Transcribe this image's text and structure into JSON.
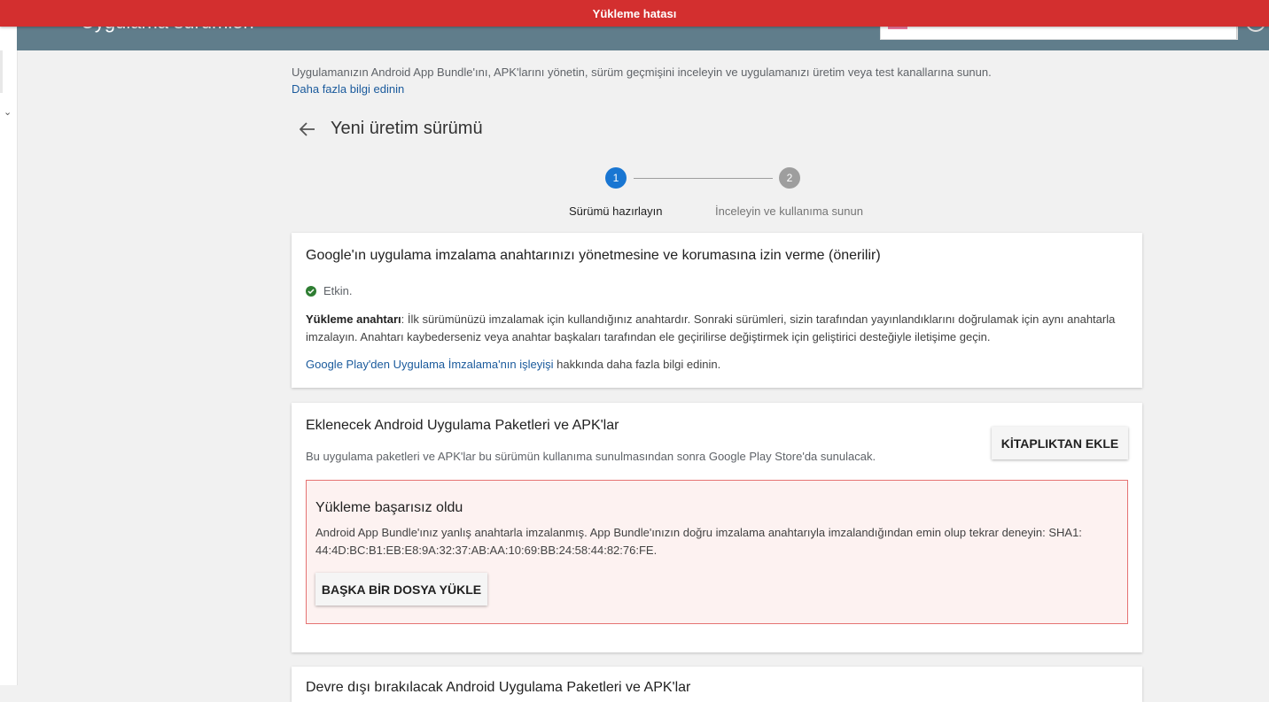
{
  "error_banner": {
    "text": "Yükleme hatası"
  },
  "header": {
    "title": "Uygulama sürümleri"
  },
  "intro": {
    "description": "Uygulamanızın Android App Bundle'ını, APK'larını yönetin, sürüm geçmişini inceleyin ve uygulamanızı üretim veya test kanallarına sunun.",
    "learn_more": "Daha fazla bilgi edinin"
  },
  "page": {
    "title": "Yeni üretim sürümü"
  },
  "stepper": {
    "steps": [
      {
        "number": "1",
        "label": "Sürümü hazırlayın",
        "active": true
      },
      {
        "number": "2",
        "label": "İnceleyin ve kullanıma sunun",
        "active": false
      }
    ]
  },
  "signing_card": {
    "title": "Google'ın uygulama imzalama anahtarınızı yönetmesine ve korumasına izin verme (önerilir)",
    "status": "Etkin.",
    "key_label": "Yükleme anahtarı",
    "key_text": ": İlk sürümünüzü imzalamak için kullandığınız anahtardır. Sonraki sürümleri, sizin tarafından yayınlandıklarını doğrulamak için aynı anahtarla imzalayın. Anahtarı kaybederseniz veya anahtar başkaları tarafından ele geçirilirse değiştirmek için geliştirici desteğiyle iletişime geçin.",
    "more_link": "Google Play'den Uygulama İmzalama'nın işleyişi",
    "more_suffix": " hakkında daha fazla bilgi edinin."
  },
  "bundles_card": {
    "title": "Eklenecek Android Uygulama Paketleri ve APK'lar",
    "description": "Bu uygulama paketleri ve APK'lar bu sürümün kullanıma sunulmasından sonra Google Play Store'da sunulacak.",
    "library_button": "KİTAPLIKTAN EKLE",
    "error": {
      "title": "Yükleme başarısız oldu",
      "message": "Android App Bundle'ınız yanlış anahtarla imzalanmış. App Bundle'ınızın doğru imzalama anahtarıyla imzalandığından emin olup tekrar deneyin: SHA1: 44:4D:BC:B1:EB:E8:9A:32:37:AB:AA:10:69:BB:24:58:44:82:76:FE.",
      "upload_button": "BAŞKA BİR DOSYA YÜKLE"
    }
  },
  "removed_card": {
    "title": "Devre dışı bırakılacak Android Uygulama Paketleri ve APK'lar"
  },
  "colors": {
    "banner": "#d32f2f",
    "header": "#607d8b",
    "step_active": "#1976d2",
    "step_inactive": "#9e9e9e",
    "link": "#1a5a9c",
    "success": "#2e7d32",
    "error_border": "#e57373",
    "error_bg": "#fdf2f1"
  },
  "icons": [
    "back-arrow-icon",
    "check-circle-icon",
    "chevron-down-icon"
  ]
}
